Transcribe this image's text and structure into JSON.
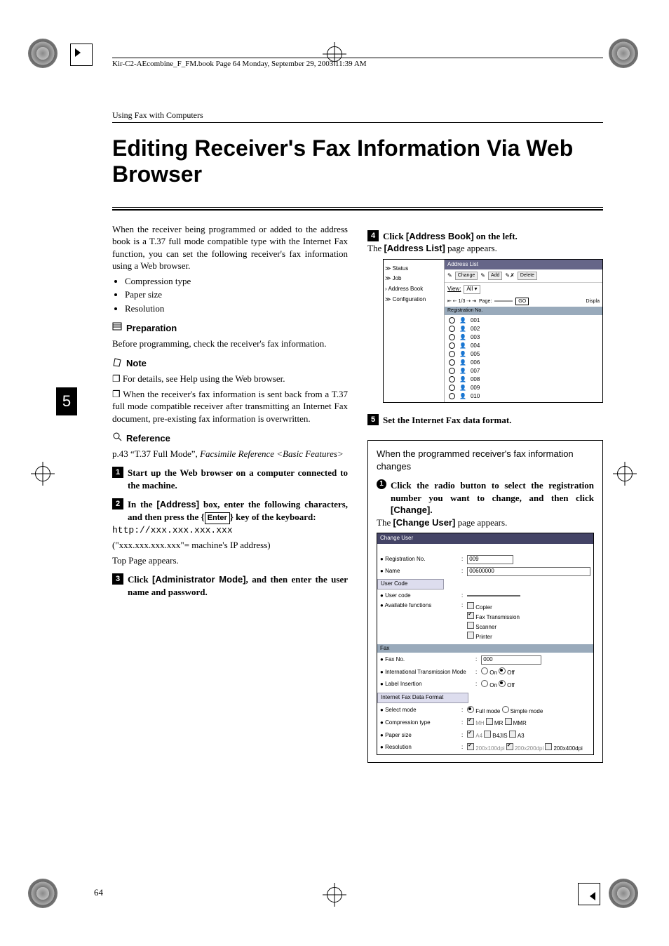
{
  "header_line": "Kir-C2-AEcombine_F_FM.book  Page 64  Monday, September 29, 2003  11:39 AM",
  "section_header": "Using Fax with Computers",
  "title": "Editing Receiver's Fax Information Via Web Browser",
  "side_tab": "5",
  "page_num": "64",
  "intro": "When the receiver being programmed or added to the address book is a T.37 full mode compatible type with the Internet Fax function, you can set the following receiver's fax information using a Web browser.",
  "bullets": [
    "Compression type",
    "Paper size",
    "Resolution"
  ],
  "prep_label": "Preparation",
  "prep_text": "Before programming, check the receiver's fax information.",
  "note_label": "Note",
  "notes": [
    "For details, see Help using the Web browser.",
    "When the receiver's fax information is sent back from a T.37 full mode compatible receiver after transmitting an Internet Fax document, pre-existing fax information is overwritten."
  ],
  "ref_label": "Reference",
  "ref_text_a": "p.43 “T.37 Full Mode”, ",
  "ref_text_b": "Facsimile Reference <Basic Features>",
  "steps": {
    "s1": {
      "n": "1",
      "t": "Start up the Web browser on a computer connected to the machine."
    },
    "s2": {
      "n": "2",
      "pre": "In the ",
      "bold": "[Address]",
      "mid": " box, enter the following characters, and then press the ",
      "key": "Enter",
      "post": " key of the keyboard:"
    },
    "s2_url": "http://xxx.xxx.xxx.xxx",
    "s2_exp": "(\"xxx.xxx.xxx.xxx\"= machine's IP address)",
    "s2_res": "Top Page appears.",
    "s3": {
      "n": "3",
      "pre": "Click ",
      "bold": "[Administrator Mode]",
      "post": ", and then enter the user name and password."
    },
    "s4": {
      "n": "4",
      "pre": "Click ",
      "bold": "[Address Book]",
      "post": " on the left."
    },
    "s4_res_a": "The ",
    "s4_res_b": "[Address List]",
    "s4_res_c": " page appears.",
    "s5": {
      "n": "5",
      "t": "Set the Internet Fax data format."
    }
  },
  "al": {
    "title": "Address List",
    "nav": [
      "≫  Status",
      "≫  Job",
      "›  Address Book",
      "≫  Configuration"
    ],
    "btns": [
      "Change",
      "Add",
      "Delete"
    ],
    "view_lbl": "View:",
    "view_val": "All",
    "pager_a": "⇤ ⇠ 1/3 ⇢ ⇥",
    "pager_b": "Page:",
    "go": "GO",
    "disp": "Displa",
    "head": "Registration No.",
    "rows": [
      "001",
      "002",
      "003",
      "004",
      "005",
      "006",
      "007",
      "008",
      "009",
      "010"
    ]
  },
  "box_head": "When the programmed receiver's fax information changes",
  "sub1_a": "Click the radio button to select the registration number you want to change, and then click ",
  "sub1_b": "[Change]",
  "sub1_c": ".",
  "sub1_res_a": "The ",
  "sub1_res_b": "[Change User]",
  "sub1_res_c": " page appears.",
  "cu": {
    "title": "Change User",
    "reg_lbl": "Registration No.",
    "reg_val": "009",
    "name_lbl": "Name",
    "name_val": "00600000",
    "uc_section": "User Code",
    "uc_lbl": "User code",
    "uc_val": "",
    "af_lbl": "Available functions",
    "af_opts": [
      "Copier",
      "Fax Transmission",
      "Scanner",
      "Printer"
    ],
    "fax_bar": "Fax",
    "fax_lbl": "Fax No.",
    "fax_val": "000",
    "itm_lbl": "International Transmission Mode",
    "li_lbl": "Label Insertion",
    "on": "On",
    "off": "Off",
    "ifdf_section": "Internet Fax Data Format",
    "sm_lbl": "Select mode",
    "sm_full": "Full mode",
    "sm_simple": "Simple mode",
    "ct_lbl": "Compression type",
    "ct_opts": [
      "MH",
      "MR",
      "MMR"
    ],
    "ps_lbl": "Paper size",
    "ps_opts": [
      "A4",
      "B4JIS",
      "A3"
    ],
    "res_lbl": "Resolution",
    "res_opts": [
      "200x100dpi",
      "200x200dpi",
      "200x400dpi"
    ]
  }
}
